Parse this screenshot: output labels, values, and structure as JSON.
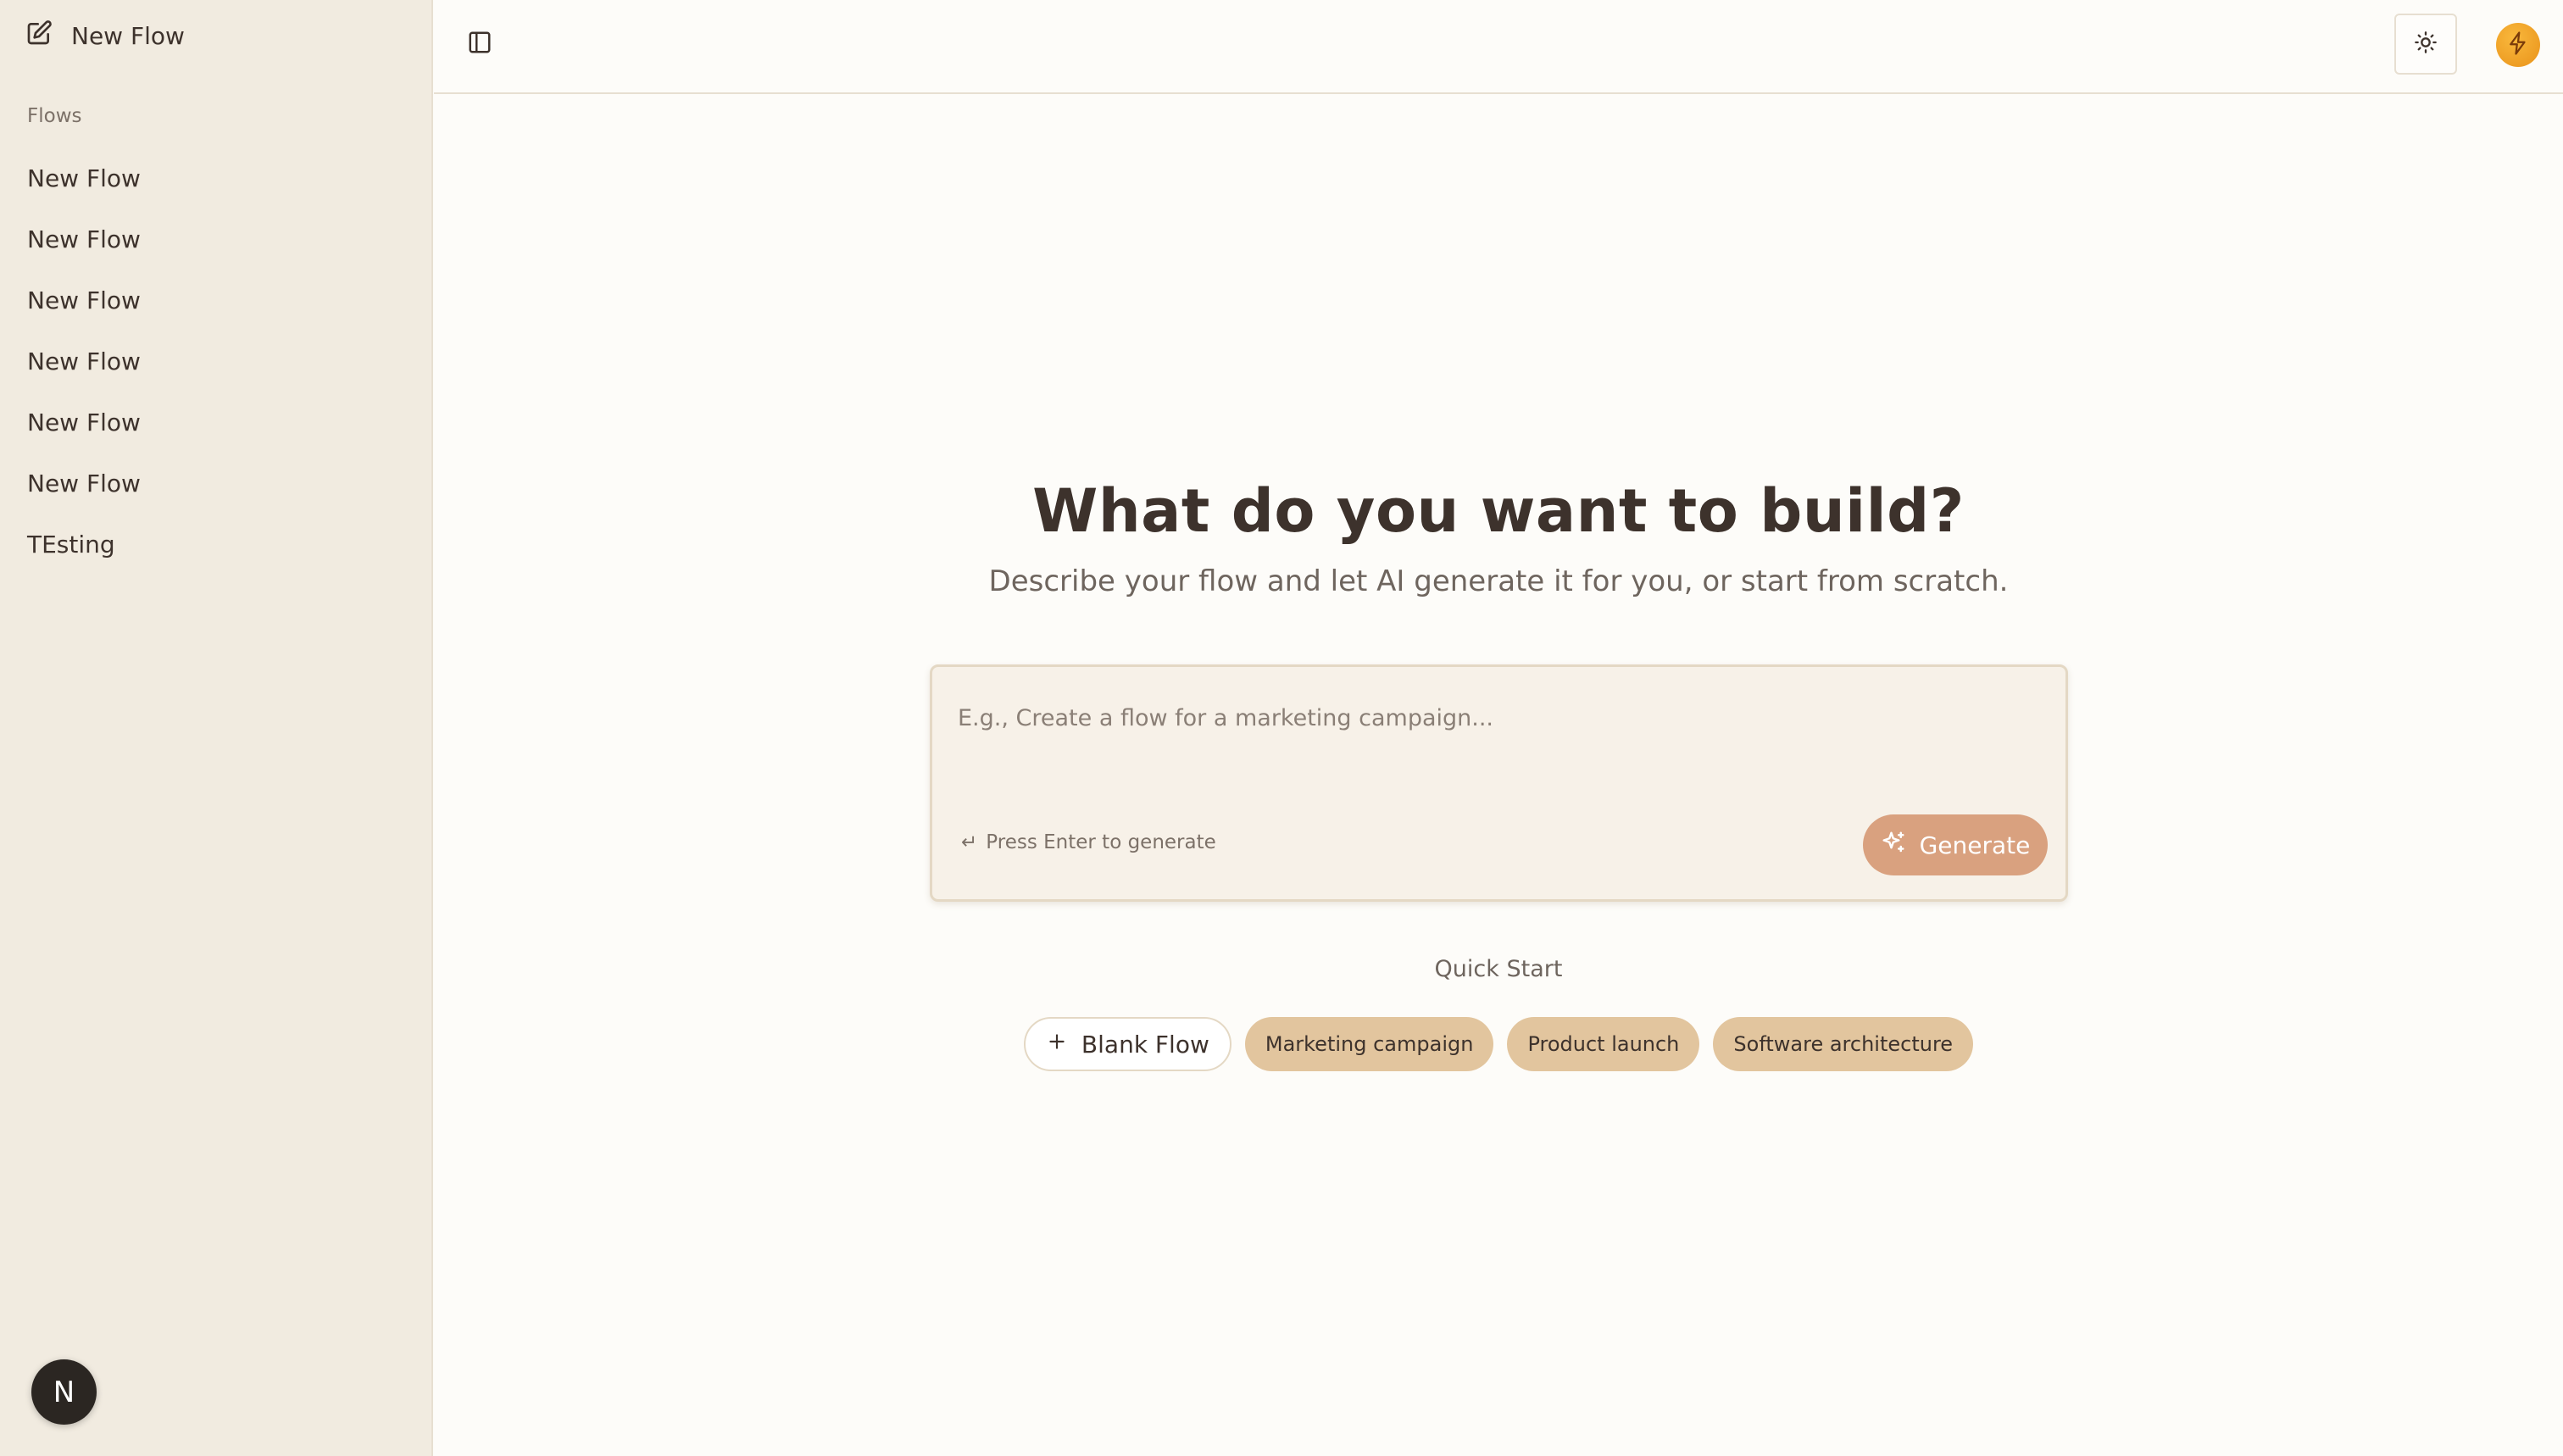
{
  "sidebar": {
    "new_flow_label": "New Flow",
    "flows_heading": "Flows",
    "flows": [
      {
        "label": "New Flow"
      },
      {
        "label": "New Flow"
      },
      {
        "label": "New Flow"
      },
      {
        "label": "New Flow"
      },
      {
        "label": "New Flow"
      },
      {
        "label": "New Flow"
      },
      {
        "label": "TEsting"
      }
    ],
    "badge_letter": "N"
  },
  "header": {
    "toggle_icon": "panel-left-icon",
    "theme_icon": "sun-icon",
    "avatar_icon": "lightning-icon"
  },
  "main": {
    "title": "What do you want to build?",
    "subtitle": "Describe your flow and let AI generate it for you, or start from scratch.",
    "prompt": {
      "value": "",
      "placeholder": "E.g., Create a flow for a marketing campaign...",
      "hint": "Press Enter to generate",
      "generate_label": "Generate"
    },
    "quick_start_label": "Quick Start",
    "quick_start": {
      "blank": "Blank Flow",
      "chips": [
        "Marketing campaign",
        "Product launch",
        "Software architecture"
      ]
    }
  },
  "colors": {
    "sidebar_bg": "#f1ebe0",
    "page_bg": "#fdfcf9",
    "accent": "#d9a17f",
    "chip_bg": "#e2c59e",
    "text": "#3d322c"
  }
}
